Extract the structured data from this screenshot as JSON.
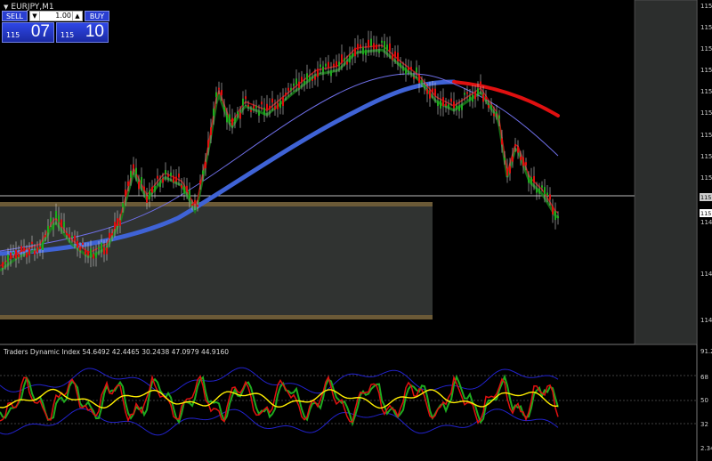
{
  "window": {
    "symbol_title": "EURJPY,M1"
  },
  "trade_panel": {
    "sell_label": "SELL",
    "buy_label": "BUY",
    "lot_size": "1.00",
    "sell_price_small": "115",
    "sell_price_big": "07",
    "buy_price_small": "115",
    "buy_price_big": "10"
  },
  "price_axis": {
    "labels": [
      "115",
      "115",
      "115",
      "115",
      "115",
      "115",
      "115",
      "115",
      "115",
      "115",
      "114",
      "114",
      "114"
    ],
    "current_price_tag": "115",
    "crosshair_tag": "115"
  },
  "indicator": {
    "title": "Traders Dynamic Index 54.6492 42.4465 30.2438 47.0979 44.9160",
    "axis_labels": [
      "91.2",
      "68",
      "50",
      "32",
      "2.34"
    ]
  },
  "colors": {
    "background": "#000000",
    "bull_candle": "#1faa1f",
    "bear_candle": "#e01010",
    "slow_ma": "#3f63d6",
    "fast_ma_red": "#e01010",
    "thin_ma": "#6f6fe8",
    "zone_border": "#6b5a37",
    "zone_fill": "#303331",
    "tdi_signal": "#ffee00",
    "tdi_band": "#2222cc"
  }
}
